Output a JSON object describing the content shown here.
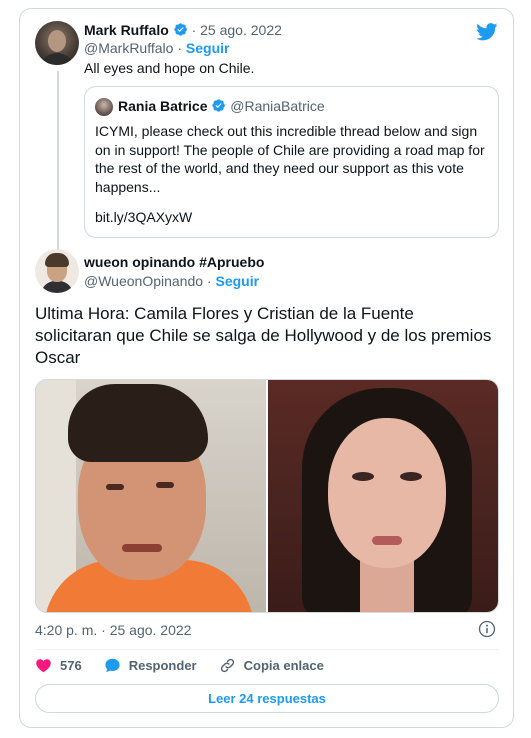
{
  "parent_tweet": {
    "display_name": "Mark Ruffalo",
    "separator": "·",
    "date": "25 ago. 2022",
    "handle": "@MarkRuffalo",
    "follow_label": "Seguir",
    "text": "All eyes and hope on Chile."
  },
  "quoted_tweet": {
    "display_name": "Rania Batrice",
    "handle": "@RaniaBatrice",
    "text": "ICYMI, please check out this incredible thread below and sign on in support! The people of Chile are providing a road map for the rest of the world, and they need our support as this vote happens...",
    "link": "bit.ly/3QAXyxW"
  },
  "main_tweet": {
    "display_name": "wueon opinando #Apruebo",
    "handle": "@WueonOpinando",
    "separator": "·",
    "follow_label": "Seguir",
    "text": "Ultima Hora: Camila Flores y Cristian de la Fuente solicitaran que Chile se salga de Hollywood y de los premios Oscar",
    "timestamp": "4:20 p. m. · 25 ago. 2022"
  },
  "actions": {
    "likes_count": "576",
    "reply_label": "Responder",
    "copy_link_label": "Copia enlace",
    "read_replies_label": "Leer 24 respuestas"
  },
  "colors": {
    "accent": "#1d9bf0",
    "like": "#f91880",
    "muted": "#536471",
    "border": "#cfd9de"
  },
  "icons": [
    "twitter-bird-icon",
    "verified-badge-icon",
    "info-icon",
    "heart-icon",
    "reply-bubble-icon",
    "link-icon"
  ]
}
